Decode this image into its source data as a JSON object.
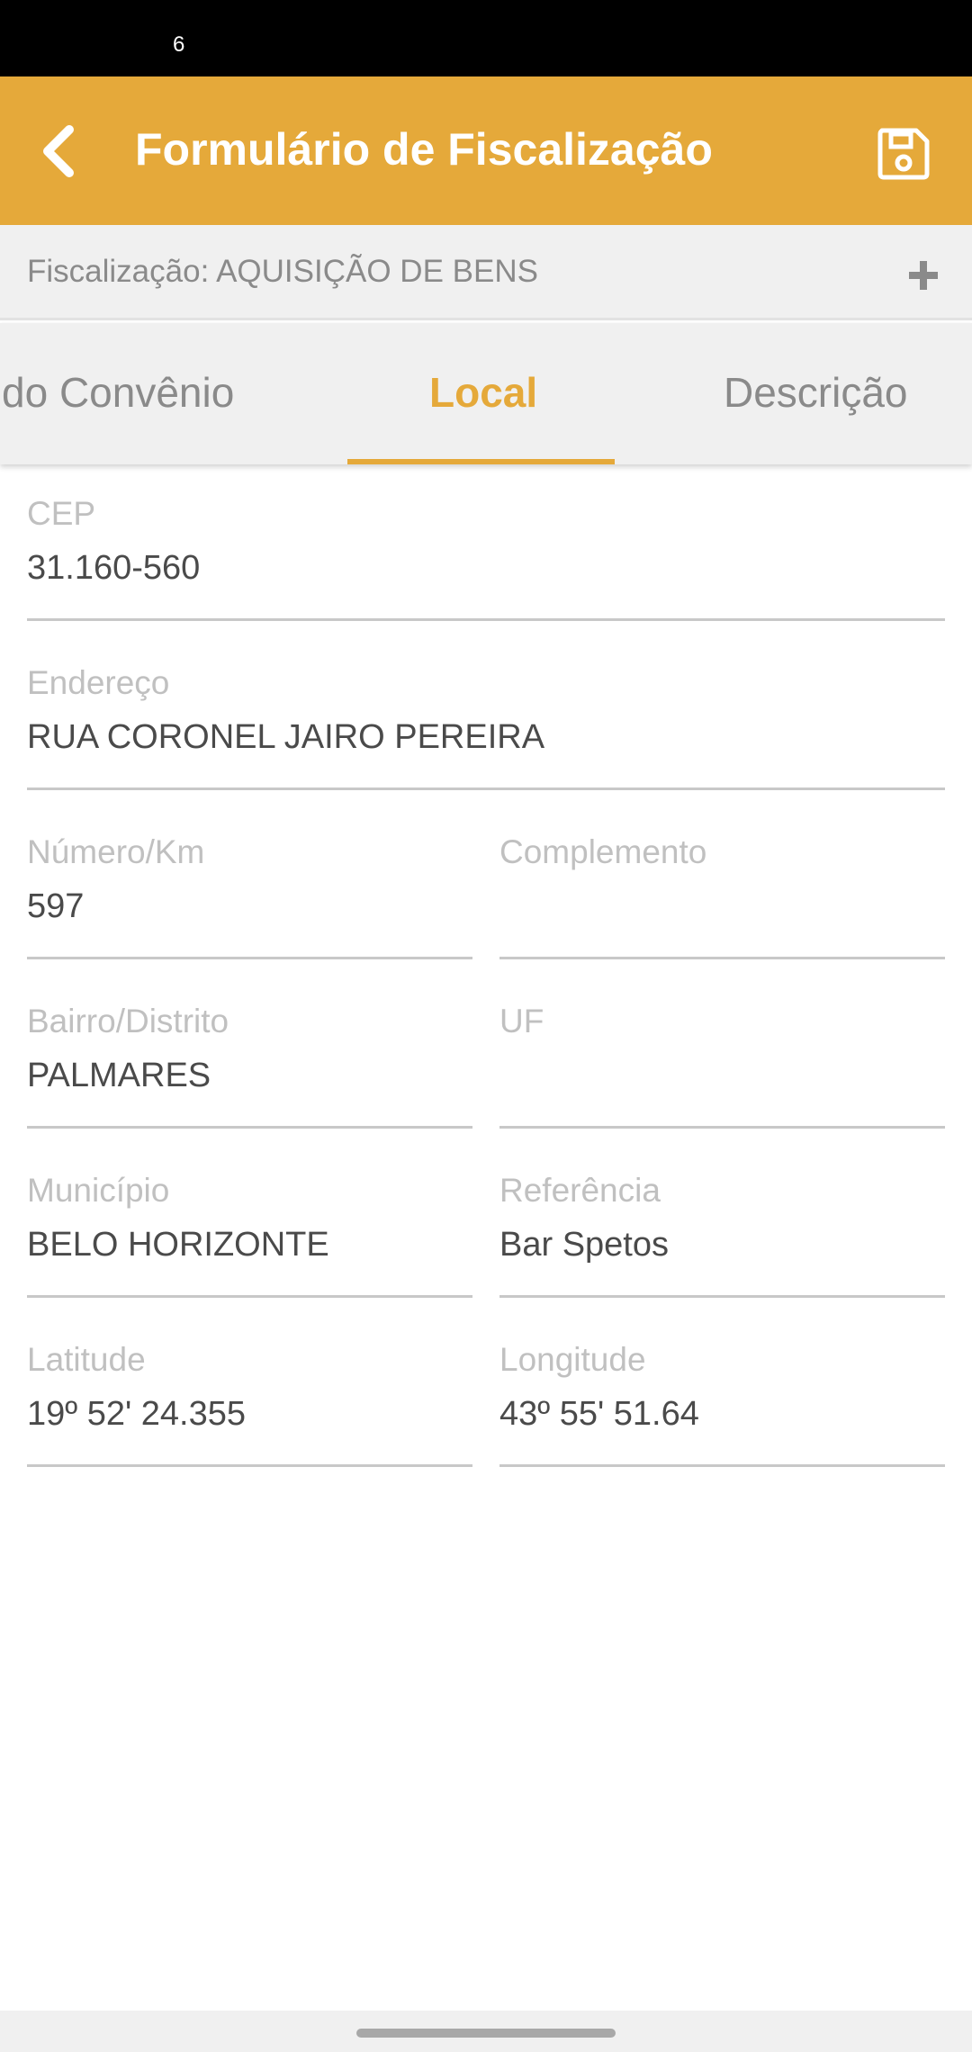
{
  "status_bar": {
    "indicator": "6"
  },
  "app_bar": {
    "title": "Formulário de Fiscalização",
    "back_icon": "chevron-left-icon",
    "save_icon": "floppy-disk-icon",
    "color": "#e5a93a"
  },
  "sub_header": {
    "label": "Fiscalização: AQUISIÇÃO DE BENS",
    "add_icon": "plus-icon"
  },
  "tabs": [
    {
      "label": "do Convênio",
      "active": false
    },
    {
      "label": "Local",
      "active": true
    },
    {
      "label": "Descrição",
      "active": false
    }
  ],
  "form": {
    "cep": {
      "label": "CEP",
      "value": "31.160-560"
    },
    "endereco": {
      "label": "Endereço",
      "value": "RUA  CORONEL  JAIRO PEREIRA"
    },
    "numero": {
      "label": "Número/Km",
      "value": "597"
    },
    "complemento": {
      "label": "Complemento",
      "value": ""
    },
    "bairro": {
      "label": "Bairro/Distrito",
      "value": "PALMARES"
    },
    "uf": {
      "label": "UF",
      "value": ""
    },
    "municipio": {
      "label": "Município",
      "value": "BELO HORIZONTE"
    },
    "referencia": {
      "label": "Referência",
      "value": "Bar Spetos"
    },
    "latitude": {
      "label": "Latitude",
      "value": "19º 52' 24.355"
    },
    "longitude": {
      "label": "Longitude",
      "value": "43º 55' 51.64"
    }
  }
}
